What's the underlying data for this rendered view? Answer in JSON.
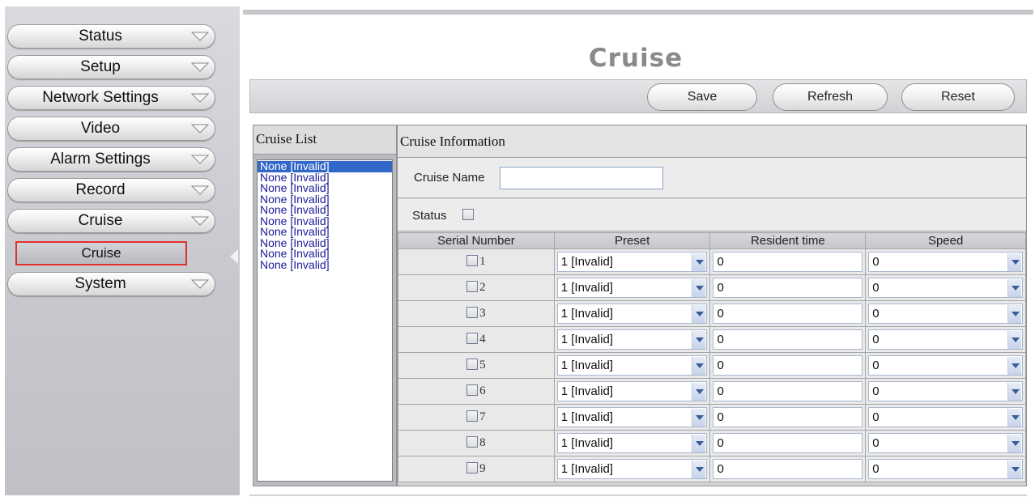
{
  "sidebar": {
    "items": [
      {
        "label": "Status"
      },
      {
        "label": "Setup"
      },
      {
        "label": "Network Settings"
      },
      {
        "label": "Video"
      },
      {
        "label": "Alarm Settings"
      },
      {
        "label": "Record"
      },
      {
        "label": "Cruise"
      }
    ],
    "sub_item": "Cruise",
    "last_item": "System"
  },
  "page": {
    "title": "Cruise"
  },
  "toolbar": {
    "save_label": "Save",
    "refresh_label": "Refresh",
    "reset_label": "Reset"
  },
  "cruise_list": {
    "header": "Cruise List",
    "items": [
      "None [Invalid]",
      "None [Invalid]",
      "None [Invalid]",
      "None [Invalid]",
      "None [Invalid]",
      "None [Invalid]",
      "None [Invalid]",
      "None [Invalid]",
      "None [Invalid]",
      "None [Invalid]"
    ]
  },
  "cruise_info": {
    "header": "Cruise Information",
    "name_label": "Cruise Name",
    "name_value": "",
    "status_label": "Status",
    "columns": [
      "Serial Number",
      "Preset",
      "Resident time",
      "Speed"
    ],
    "rows": [
      {
        "serial": "1",
        "preset": "1 [Invalid]",
        "resident": "0",
        "speed": "0"
      },
      {
        "serial": "2",
        "preset": "1 [Invalid]",
        "resident": "0",
        "speed": "0"
      },
      {
        "serial": "3",
        "preset": "1 [Invalid]",
        "resident": "0",
        "speed": "0"
      },
      {
        "serial": "4",
        "preset": "1 [Invalid]",
        "resident": "0",
        "speed": "0"
      },
      {
        "serial": "5",
        "preset": "1 [Invalid]",
        "resident": "0",
        "speed": "0"
      },
      {
        "serial": "6",
        "preset": "1 [Invalid]",
        "resident": "0",
        "speed": "0"
      },
      {
        "serial": "7",
        "preset": "1 [Invalid]",
        "resident": "0",
        "speed": "0"
      },
      {
        "serial": "8",
        "preset": "1 [Invalid]",
        "resident": "0",
        "speed": "0"
      },
      {
        "serial": "9",
        "preset": "1 [Invalid]",
        "resident": "0",
        "speed": "0"
      }
    ]
  },
  "colors": {
    "selected_item": "#3167c9",
    "highlight_border": "#e0312f",
    "title_gray": "#8a8a8a"
  }
}
